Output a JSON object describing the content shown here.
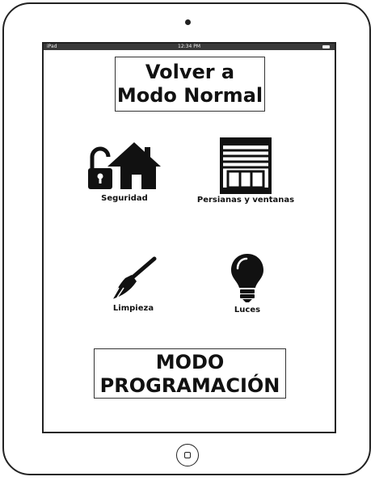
{
  "status_bar": {
    "carrier": "iPad",
    "time": "12:34 PM"
  },
  "buttons": {
    "normal_mode_line1": "Volver a",
    "normal_mode_line2": "Modo Normal",
    "programming_line1": "MODO",
    "programming_line2": "PROGRAMACIÓN"
  },
  "tiles": [
    {
      "label": "Seguridad",
      "icon": "house-lock-icon"
    },
    {
      "label": "Persianas y ventanas",
      "icon": "window-blinds-icon"
    },
    {
      "label": "Limpieza",
      "icon": "broom-icon"
    },
    {
      "label": "Luces",
      "icon": "lightbulb-icon"
    }
  ]
}
